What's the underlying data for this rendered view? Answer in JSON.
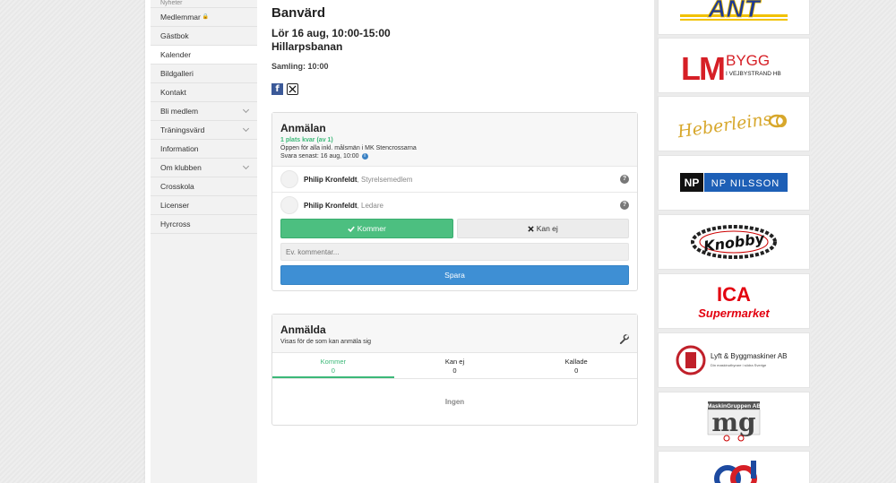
{
  "sidebar": {
    "items": [
      {
        "label": "Nyheter",
        "chevron": false,
        "lock": false
      },
      {
        "label": "Medlemmar",
        "chevron": false,
        "lock": true
      },
      {
        "label": "Gästbok",
        "chevron": false,
        "lock": false
      },
      {
        "label": "Kalender",
        "chevron": false,
        "lock": false,
        "active": true
      },
      {
        "label": "Bildgalleri",
        "chevron": false,
        "lock": false
      },
      {
        "label": "Kontakt",
        "chevron": false,
        "lock": false
      },
      {
        "label": "Bli medlem",
        "chevron": true,
        "lock": false
      },
      {
        "label": "Träningsvärd",
        "chevron": true,
        "lock": false
      },
      {
        "label": "Information",
        "chevron": false,
        "lock": false
      },
      {
        "label": "Om klubben",
        "chevron": true,
        "lock": false
      },
      {
        "label": "Crosskola",
        "chevron": false,
        "lock": false
      },
      {
        "label": "Licenser",
        "chevron": false,
        "lock": false
      },
      {
        "label": "Hyrcross",
        "chevron": false,
        "lock": false
      }
    ]
  },
  "event": {
    "title": "Banvärd",
    "date": "Lör 16 aug, 10:00-15:00",
    "place": "Hillarpsbanan",
    "gathering": "Samling: 10:00",
    "share_icons": [
      "facebook-icon",
      "x-icon"
    ]
  },
  "signup": {
    "heading": "Anmälan",
    "availability": "1 plats kvar (av 1)",
    "open_for": "Öppen för alla inkl. målsmän i MK Stencrossarna",
    "deadline": "Svara senast: 16 aug, 10:00",
    "people": [
      {
        "name": "Philip Kronfeldt",
        "role": "Styrelsemedlem"
      },
      {
        "name": "Philip Kronfeldt",
        "role": "Ledare"
      }
    ],
    "role_separator": ", ",
    "yes_label": "Kommer",
    "no_label": "Kan ej",
    "comment_placeholder": "Ev. kommentar...",
    "save_label": "Spara"
  },
  "registered": {
    "heading": "Anmälda",
    "subtitle": "Visas för de som kan anmäla sig",
    "tabs": [
      {
        "label": "Kommer",
        "count": "0",
        "active": true
      },
      {
        "label": "Kan ej",
        "count": "0",
        "active": false
      },
      {
        "label": "Kallade",
        "count": "0",
        "active": false
      }
    ],
    "empty_text": "Ingen"
  },
  "sponsors": {
    "logos": [
      {
        "name": "ant-logo",
        "text": "ANT"
      },
      {
        "name": "lm-bygg-logo",
        "text_main": "LM",
        "text_bygg": "BYGG",
        "text_sub": "I VEJBYSTRAND HB"
      },
      {
        "name": "heberleins-logo",
        "text": "Heberleins"
      },
      {
        "name": "np-nilsson-logo",
        "text_np": "NP",
        "text_name": "NP NILSSON"
      },
      {
        "name": "knobby-logo",
        "text": "Knobby"
      },
      {
        "name": "ica-logo",
        "text_ica": "ICA",
        "text_sub": "Supermarket"
      },
      {
        "name": "lyft-bygg-logo",
        "text": "Lyft & Byggmaskiner AB",
        "text_sub": "Din maskinuthyrare i södra Sverige"
      },
      {
        "name": "maskingruppen-logo",
        "text_top": "MaskinGruppen AB",
        "text_mg": "mg"
      },
      {
        "name": "partial-logo"
      }
    ],
    "colors": {
      "ant_blue": "#1f3a93",
      "ant_yellow": "#f2c200",
      "lm_red": "#d61f26",
      "heberleins_gold": "#d7a72b",
      "np_blue": "#1d5fb6",
      "ica_red": "#e3000f"
    }
  }
}
